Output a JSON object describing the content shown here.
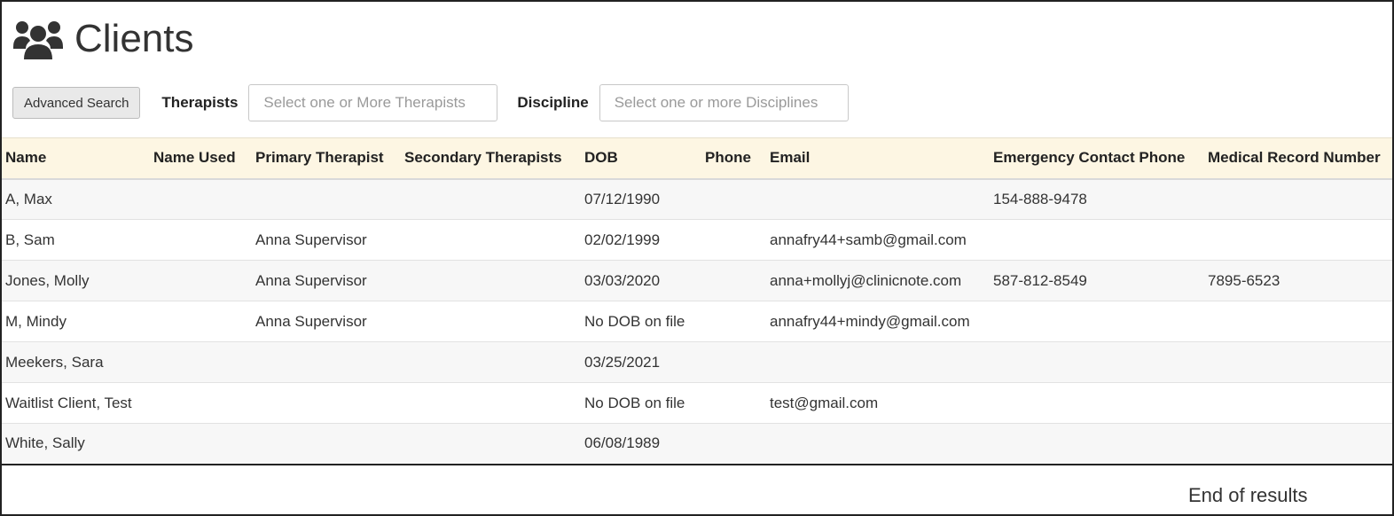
{
  "header": {
    "title": "Clients",
    "icon": "users-icon"
  },
  "filters": {
    "advanced_search_label": "Advanced Search",
    "therapists_label": "Therapists",
    "therapists_placeholder": "Select one or More Therapists",
    "discipline_label": "Discipline",
    "discipline_placeholder": "Select one or more Disciplines"
  },
  "table": {
    "columns": [
      "Name",
      "Name Used",
      "Primary Therapist",
      "Secondary Therapists",
      "DOB",
      "Phone",
      "Email",
      "Emergency Contact Phone",
      "Medical Record Number"
    ],
    "rows": [
      [
        "A, Max",
        "",
        "",
        "",
        "07/12/1990",
        "",
        "",
        "154-888-9478",
        ""
      ],
      [
        "B, Sam",
        "",
        "Anna Supervisor",
        "",
        "02/02/1999",
        "",
        "annafry44+samb@gmail.com",
        "",
        ""
      ],
      [
        "Jones, Molly",
        "",
        "Anna Supervisor",
        "",
        "03/03/2020",
        "",
        "anna+mollyj@clinicnote.com",
        "587-812-8549",
        "7895-6523"
      ],
      [
        "M, Mindy",
        "",
        "Anna Supervisor",
        "",
        "No DOB on file",
        "",
        "annafry44+mindy@gmail.com",
        "",
        ""
      ],
      [
        "Meekers, Sara",
        "",
        "",
        "",
        "03/25/2021",
        "",
        "",
        "",
        ""
      ],
      [
        "Waitlist Client, Test",
        "",
        "",
        "",
        "No DOB on file",
        "",
        "test@gmail.com",
        "",
        ""
      ],
      [
        "White, Sally",
        "",
        "",
        "",
        "06/08/1989",
        "",
        "",
        "",
        ""
      ]
    ]
  },
  "footer": {
    "end_text": "End of results"
  },
  "colors": {
    "header_row_bg": "#fdf6e3",
    "row_alt_bg": "#f7f7f7"
  }
}
